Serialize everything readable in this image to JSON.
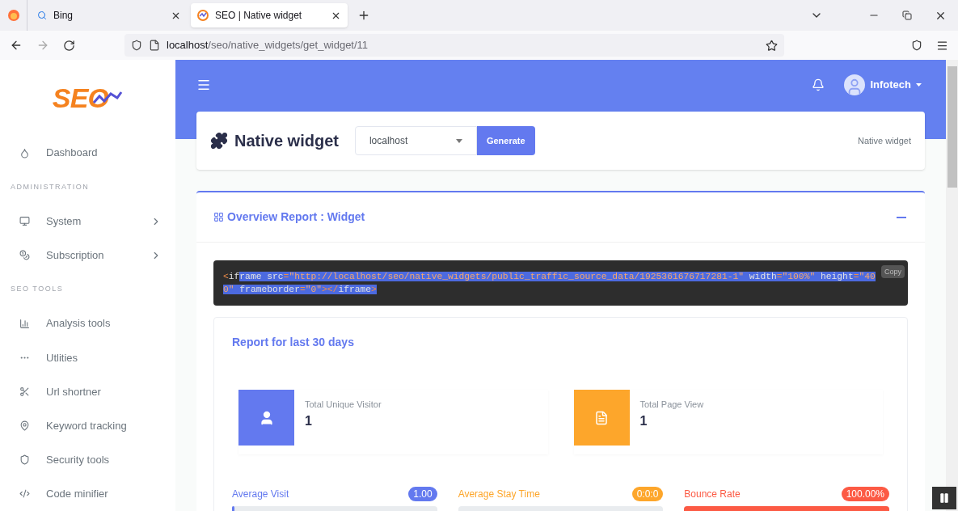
{
  "browser": {
    "tabs": [
      {
        "title": "Bing",
        "selected": false
      },
      {
        "title": "SEO | Native widget",
        "selected": true
      }
    ],
    "address": {
      "host": "localhost",
      "path": "/seo/native_widgets/get_widget/11"
    }
  },
  "sidebar": {
    "logo": "SEO",
    "items": [
      {
        "kind": "item",
        "label": "Dashboard",
        "has_arrow": false
      },
      {
        "kind": "section",
        "label": "ADMINISTRATION"
      },
      {
        "kind": "item",
        "label": "System",
        "has_arrow": true
      },
      {
        "kind": "item",
        "label": "Subscription",
        "has_arrow": true
      },
      {
        "kind": "section",
        "label": "SEO TOOLS"
      },
      {
        "kind": "item",
        "label": "Analysis tools",
        "has_arrow": false
      },
      {
        "kind": "item",
        "label": "Utlities",
        "has_arrow": false
      },
      {
        "kind": "item",
        "label": "Url shortner",
        "has_arrow": false
      },
      {
        "kind": "item",
        "label": "Keyword tracking",
        "has_arrow": false
      },
      {
        "kind": "item",
        "label": "Security tools",
        "has_arrow": false
      },
      {
        "kind": "item",
        "label": "Code minifier",
        "has_arrow": false
      }
    ]
  },
  "topbar": {
    "user": "Infotech"
  },
  "page_header": {
    "title": "Native widget",
    "domain_select": "localhost",
    "generate_button": "Generate",
    "breadcrumb": "Native widget"
  },
  "overview": {
    "title": "Overview Report : Widget",
    "expanded": true,
    "code": {
      "copy_label": "Copy",
      "tokens": [
        {
          "text": "<",
          "kind": "punct",
          "selected": false
        },
        {
          "text": "if",
          "kind": "tag",
          "selected": false
        },
        {
          "text": "rame",
          "kind": "tag",
          "selected": true
        },
        {
          "text": " src",
          "kind": "attr",
          "selected": true
        },
        {
          "text": "=",
          "kind": "punct",
          "selected": true
        },
        {
          "text": "\"http://localhost/seo/native_widgets/public_traffic_source_data/1925361676717281-1\"",
          "kind": "string",
          "selected": true
        },
        {
          "text": " width",
          "kind": "attr",
          "selected": true
        },
        {
          "text": "=",
          "kind": "punct",
          "selected": true
        },
        {
          "text": "\"100%\"",
          "kind": "string",
          "selected": true
        },
        {
          "text": " height",
          "kind": "attr",
          "selected": true
        },
        {
          "text": "=",
          "kind": "punct",
          "selected": true
        },
        {
          "text": "\"400\"",
          "kind": "string",
          "selected": true
        },
        {
          "text": " frameborder",
          "kind": "attr",
          "selected": true
        },
        {
          "text": "=",
          "kind": "punct",
          "selected": true
        },
        {
          "text": "\"0\"",
          "kind": "string",
          "selected": true
        },
        {
          "text": "></",
          "kind": "punct",
          "selected": true
        },
        {
          "text": "iframe",
          "kind": "tag",
          "selected": true
        },
        {
          "text": ">",
          "kind": "punct",
          "selected": true
        }
      ]
    },
    "report": {
      "title": "Report for last 30 days",
      "stats": [
        {
          "label": "Total Unique Visitor",
          "value": "1",
          "color": "#6379ef"
        },
        {
          "label": "Total Page View",
          "value": "1",
          "color": "#fda62b"
        }
      ],
      "metrics": [
        {
          "label": "Average Visit",
          "badge": "1.00",
          "color": "#6379ef",
          "level": 0.01
        },
        {
          "label": "Average Stay Time",
          "badge": "0:0:0",
          "color": "#fda62b",
          "level": 0
        },
        {
          "label": "Bounce Rate",
          "badge": "100.00%",
          "color": "#fc5a44",
          "level": 1
        }
      ]
    }
  }
}
